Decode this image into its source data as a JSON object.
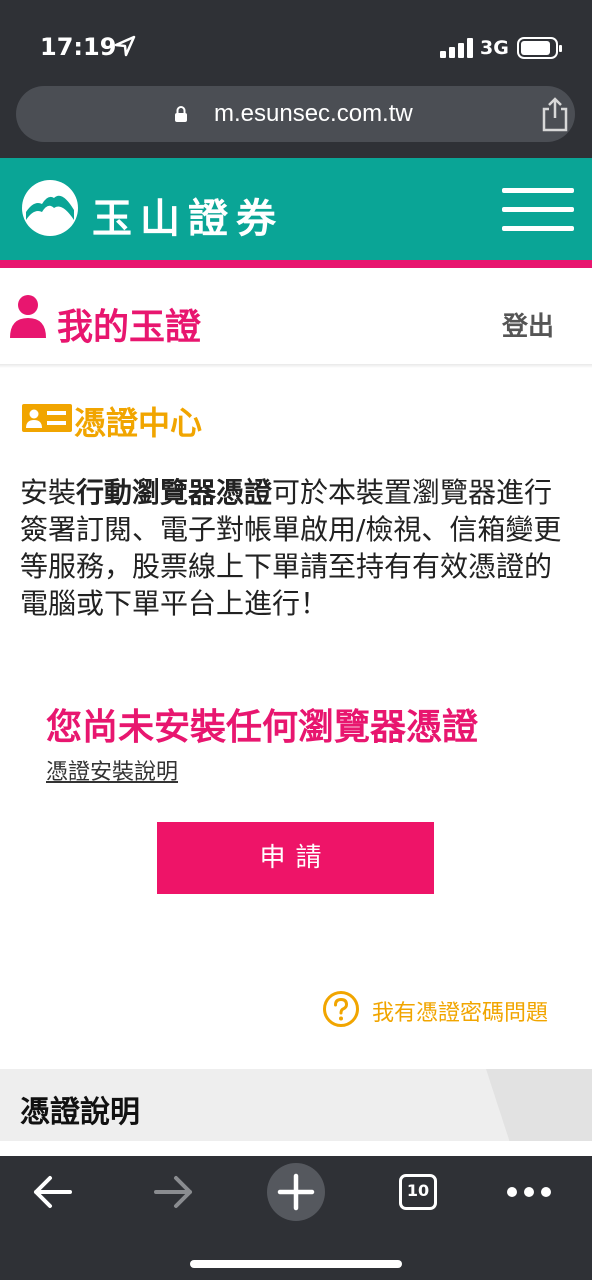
{
  "status_bar": {
    "time": "17:19",
    "network": "3G"
  },
  "browser": {
    "url": "m.esunsec.com.tw"
  },
  "header": {
    "brand_name": "玉山證券",
    "brand_color": "#0aa596",
    "accent_color": "#e8166f"
  },
  "member": {
    "title": "我的玉證",
    "logout": "登出"
  },
  "cert_center": {
    "title": "憑證中心",
    "desc_prefix": "安裝",
    "desc_bold": "行動瀏覽器憑證",
    "desc_suffix": "可於本裝置瀏覽器進行簽署訂閱、電子對帳單啟用/檢視、信箱變更等服務，股票線上下單請至持有有效憑證的電腦或下單平台上進行！",
    "notice": "您尚未安裝任何瀏覽器憑證",
    "install_guide": "憑證安裝說明",
    "apply_button": "申請",
    "help_link": "我有憑證密碼問題"
  },
  "section": {
    "title": "憑證說明"
  },
  "bottom_nav": {
    "tab_count": "10"
  },
  "icons": [
    "location-arrow-icon",
    "signal-icon",
    "battery-icon",
    "lock-icon",
    "share-icon",
    "mountain-logo-icon",
    "menu-icon",
    "person-icon",
    "id-card-icon",
    "question-icon",
    "back-arrow-icon",
    "forward-arrow-icon",
    "plus-icon",
    "tabs-icon",
    "more-icon"
  ]
}
